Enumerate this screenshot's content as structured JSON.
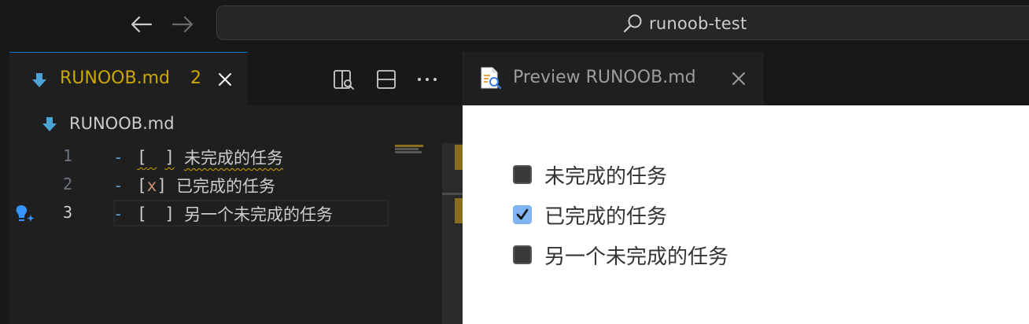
{
  "titlebar": {
    "search_text": "runoob-test"
  },
  "editor_tab": {
    "label": "RUNOOB.md",
    "problems_count": "2"
  },
  "breadcrumb": {
    "file": "RUNOOB.md"
  },
  "editor": {
    "lines": [
      {
        "number": "1",
        "bracket_open": "[",
        "mark": " ",
        "bracket_close": "]",
        "text": "未完成的任务"
      },
      {
        "number": "2",
        "bracket_open": "[",
        "mark": "x",
        "bracket_close": "]",
        "text": "已完成的任务"
      },
      {
        "number": "3",
        "bracket_open": "[",
        "mark": " ",
        "bracket_close": "]",
        "text": "另一个未完成的任务"
      }
    ],
    "list_marker": "-"
  },
  "preview_tab": {
    "label": "Preview RUNOOB.md"
  },
  "preview": {
    "items": [
      {
        "text": "未完成的任务",
        "checked": false
      },
      {
        "text": "已完成的任务",
        "checked": true
      },
      {
        "text": "另一个未完成的任务",
        "checked": false
      }
    ]
  },
  "colors": {
    "accent": "#0078d4",
    "warning": "#cca700",
    "list_marker": "#569cd6",
    "checked_box": "#7fb4f0"
  },
  "icons": {
    "back": "arrow-left-icon",
    "forward": "arrow-right-icon",
    "search": "search-icon",
    "markdown": "markdown-arrow-icon",
    "close": "close-icon",
    "open_preview": "open-preview-icon",
    "split_editor": "split-editor-icon",
    "more": "more-actions-icon",
    "lightbulb": "lightbulb-sparkle-icon",
    "preview_file": "preview-file-icon"
  }
}
